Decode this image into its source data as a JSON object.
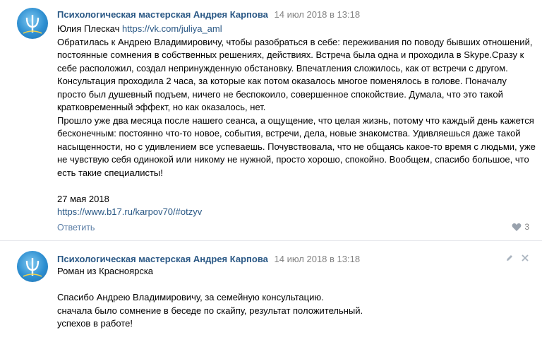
{
  "colors": {
    "link": "#2a5885",
    "meta": "#828282",
    "divider": "#e7e8ec",
    "avatar": "#2e8fd1"
  },
  "posts": [
    {
      "author": "Психологическая мастерская Андрея Карпова",
      "date": "14 июл 2018 в 13:18",
      "lines": [
        {
          "text": "Юлия Плескач ",
          "link": "https://vk.com/juliya_aml"
        },
        {
          "text": "Обратилась к Андрею Владимировичу, чтобы разобраться в себе: переживания по поводу бывших отношений,"
        },
        {
          "text": "постоянные сомнения в собственных решениях, действиях. Встреча была одна и проходила в Skype.Сразу к"
        },
        {
          "text": "себе расположил, создал непринужденную обстановку. Впечатления сложилось, как от встречи с другом."
        },
        {
          "text": "Консультация проходила 2 часа, за которые как потом оказалось многое поменялось в голове. Поначалу"
        },
        {
          "text": "просто был душевный подъем, ничего не беспокоило, совершенное спокойствие. Думала, что это такой"
        },
        {
          "text": "кратковременный эффект, но как оказалось, нет."
        },
        {
          "text": "Прошло уже два месяца после нашего сеанса, а ощущение, что целая жизнь, потому что каждый день кажется"
        },
        {
          "text": "бесконечным: постоянно что-то новое, события, встречи, дела, новые знакомства. Удивляешься даже такой"
        },
        {
          "text": "насыщенности, но с удивлением все успеваешь. Почувствовала, что не общаясь какое-то время с людьми, уже"
        },
        {
          "text": "не чувствую себя одинокой или никому не нужной, просто хорошо, спокойно. Вообщем, спасибо большое, что"
        },
        {
          "text": "есть такие специалисты!"
        },
        {
          "text": ""
        },
        {
          "text": "27 мая 2018"
        },
        {
          "text": "",
          "link": "https://www.b17.ru/karpov70/#otzyv"
        }
      ],
      "reply_label": "Ответить",
      "likes": "3"
    },
    {
      "author": "Психологическая мастерская Андрея Карпова",
      "date": "14 июл 2018 в 13:18",
      "lines": [
        {
          "text": "Роман из Красноярска"
        },
        {
          "text": ""
        },
        {
          "text": "Спасибо Андрею Владимировичу, за семейную консультацию."
        },
        {
          "text": "сначала было сомнение в беседе по скайпу, результат положительный."
        },
        {
          "text": "успехов в работе!"
        }
      ]
    }
  ]
}
